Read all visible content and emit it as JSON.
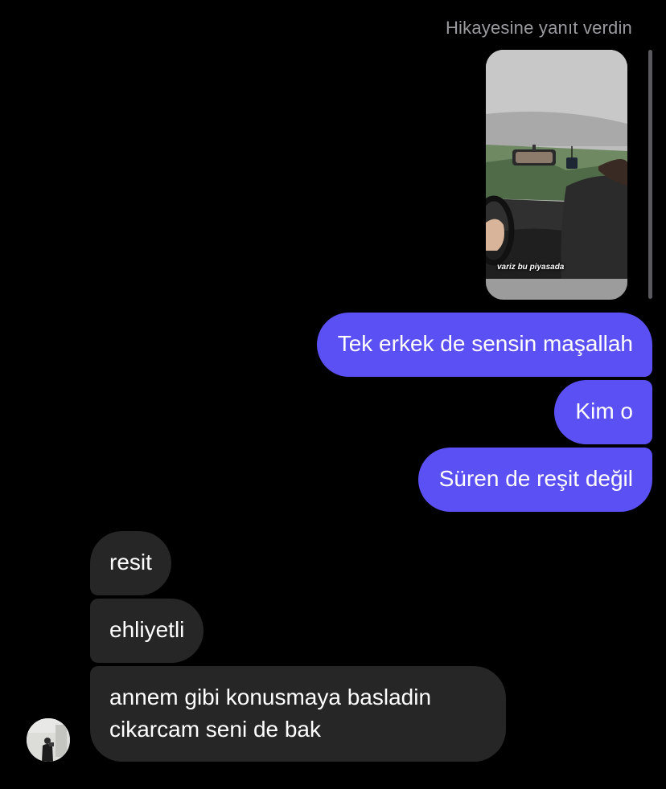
{
  "header": {
    "reply_label": "Hikayesine yanıt verdin"
  },
  "story": {
    "caption": "variz bu piyasada"
  },
  "messages": {
    "outgoing": [
      "Tek erkek de sensin maşallah",
      "Kim o",
      "Süren de reşit değil"
    ],
    "incoming": [
      "resit",
      "ehliyetli"
    ],
    "last": {
      "line1": "annem gibi konusmaya basladin",
      "line2": "cikarcam seni de bak"
    }
  },
  "colors": {
    "background": "#000000",
    "outgoing_bubble": "#5b50f4",
    "incoming_bubble": "#262626",
    "meta_text": "#9a9a9f"
  }
}
